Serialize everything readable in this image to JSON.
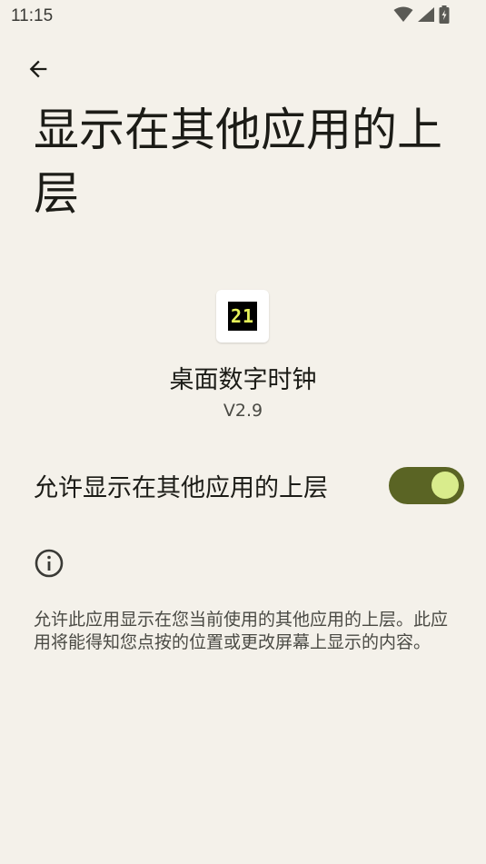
{
  "status_bar": {
    "time": "11:15",
    "icons": [
      "wifi-icon",
      "cellular-signal-icon",
      "battery-charging-icon"
    ]
  },
  "header": {
    "back_icon": "arrow-back-icon",
    "title": "显示在其他应用的上层"
  },
  "app": {
    "icon_digits": "21",
    "name": "桌面数字时钟",
    "version": "V2.9"
  },
  "permission": {
    "label": "允许显示在其他应用的上层",
    "enabled": true
  },
  "info": {
    "icon": "info-icon",
    "text": "允许此应用显示在您当前使用的其他应用的上层。此应用将能得知您点按的位置或更改屏幕上显示的内容。"
  },
  "colors": {
    "background": "#f4f1ea",
    "toggle_track": "#5a6424",
    "toggle_thumb": "#d9ec8c"
  }
}
